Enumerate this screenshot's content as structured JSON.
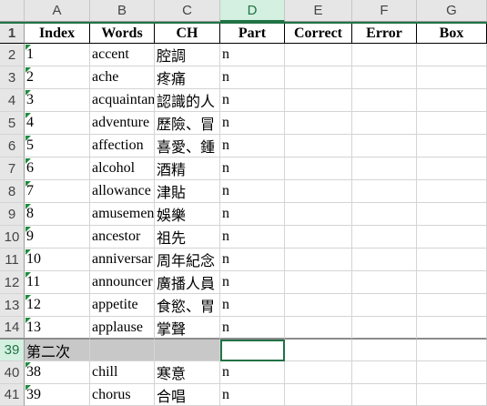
{
  "columns": [
    "A",
    "B",
    "C",
    "D",
    "E",
    "F",
    "G"
  ],
  "header_row": {
    "row_number": "1",
    "cells": [
      "Index",
      "Words",
      "CH",
      "Part",
      "Correct",
      "Error",
      "Box"
    ]
  },
  "rows": [
    {
      "row_number": "2",
      "cells": [
        "1",
        "accent",
        "腔調",
        "n",
        "",
        "",
        ""
      ]
    },
    {
      "row_number": "3",
      "cells": [
        "2",
        "ache",
        "疼痛",
        "n",
        "",
        "",
        ""
      ]
    },
    {
      "row_number": "4",
      "cells": [
        "3",
        "acquaintan",
        "認識的人",
        "n",
        "",
        "",
        ""
      ]
    },
    {
      "row_number": "5",
      "cells": [
        "4",
        "adventure",
        "歷險、冒",
        "n",
        "",
        "",
        ""
      ]
    },
    {
      "row_number": "6",
      "cells": [
        "5",
        "affection",
        "喜愛、鍾",
        "n",
        "",
        "",
        ""
      ]
    },
    {
      "row_number": "7",
      "cells": [
        "6",
        "alcohol",
        "酒精",
        "n",
        "",
        "",
        ""
      ]
    },
    {
      "row_number": "8",
      "cells": [
        "7",
        "allowance",
        "津貼",
        "n",
        "",
        "",
        ""
      ]
    },
    {
      "row_number": "9",
      "cells": [
        "8",
        "amusemen",
        "娛樂",
        "n",
        "",
        "",
        ""
      ]
    },
    {
      "row_number": "10",
      "cells": [
        "9",
        "ancestor",
        "祖先",
        "n",
        "",
        "",
        ""
      ]
    },
    {
      "row_number": "11",
      "cells": [
        "10",
        "anniversar",
        "周年紀念",
        "n",
        "",
        "",
        ""
      ]
    },
    {
      "row_number": "12",
      "cells": [
        "11",
        "announcer",
        "廣播人員",
        "n",
        "",
        "",
        ""
      ]
    },
    {
      "row_number": "13",
      "cells": [
        "12",
        "appetite",
        "食慾、胃",
        "n",
        "",
        "",
        ""
      ]
    },
    {
      "row_number": "14",
      "cells": [
        "13",
        "applause",
        "掌聲",
        "n",
        "",
        "",
        ""
      ]
    },
    {
      "row_number": "39",
      "cells": [
        "第二次",
        "",
        "",
        "",
        "",
        "",
        ""
      ],
      "group": true
    },
    {
      "row_number": "40",
      "cells": [
        "38",
        "chill",
        "寒意",
        "n",
        "",
        "",
        ""
      ]
    },
    {
      "row_number": "41",
      "cells": [
        "39",
        "chorus",
        "合唱",
        "n",
        "",
        "",
        ""
      ]
    }
  ],
  "selected_cell": {
    "row": "39",
    "col": "D"
  },
  "colors": {
    "accent": "#217346",
    "header_bg": "#e6e6e6",
    "group_row_bg": "#c8c8c8",
    "number_marker": "#1e8c3e"
  }
}
